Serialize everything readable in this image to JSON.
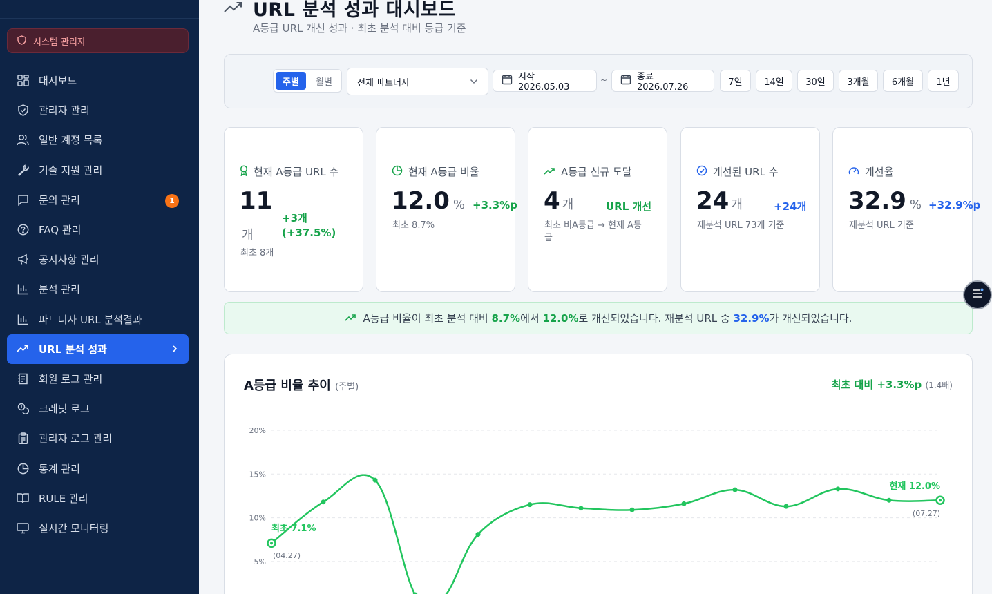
{
  "sidebar": {
    "admin_label": "시스템 관리자",
    "items": [
      {
        "label": "대시보드",
        "icon": "grid-icon"
      },
      {
        "label": "관리자 관리",
        "icon": "shield-icon"
      },
      {
        "label": "일반 계정 목록",
        "icon": "users-icon"
      },
      {
        "label": "기술 지원 관리",
        "icon": "wrench-icon"
      },
      {
        "label": "문의 관리",
        "icon": "message-icon",
        "badge": "1"
      },
      {
        "label": "FAQ 관리",
        "icon": "help-icon"
      },
      {
        "label": "공지사항 관리",
        "icon": "megaphone-icon"
      },
      {
        "label": "분석 관리",
        "icon": "bar-chart-icon"
      },
      {
        "label": "파트너사 URL 분석결과",
        "icon": "bar-chart-icon"
      },
      {
        "label": "URL 분석 성과",
        "icon": "trending-up-icon",
        "active": true
      },
      {
        "label": "회원 로그 관리",
        "icon": "log-icon"
      },
      {
        "label": "크레딧 로그",
        "icon": "coins-icon"
      },
      {
        "label": "관리자 로그 관리",
        "icon": "clipboard-icon"
      },
      {
        "label": "통계 관리",
        "icon": "pie-icon"
      },
      {
        "label": "RULE 관리",
        "icon": "book-icon"
      },
      {
        "label": "실시간 모니터링",
        "icon": "monitor-icon"
      }
    ]
  },
  "header": {
    "title": "URL 분석 성과 대시보드",
    "subtitle": "A등급 URL 개선 성과 · 최초 분석 대비 등급 기준"
  },
  "filters": {
    "period_weekly": "주별",
    "period_monthly": "월별",
    "partner_select": "전체 파트너사",
    "start_label": "시작 2026.05.03",
    "tilde": "~",
    "end_label": "종료 2026.07.26",
    "ranges": [
      "7일",
      "14일",
      "30일",
      "3개월",
      "6개월",
      "1년"
    ]
  },
  "cards": {
    "c1": {
      "label": "현재 A등급 URL 수",
      "value": "11",
      "unit": "개",
      "delta1": "+3개",
      "delta2": "(+37.5%)",
      "note": "최초 8개"
    },
    "c2": {
      "label": "현재 A등급 비율",
      "value": "12.0",
      "unit": "%",
      "delta": "+3.3%p",
      "note": "최초 8.7%"
    },
    "c3": {
      "label": "A등급 신규 도달",
      "value": "4",
      "unit": "개",
      "delta": "URL 개선",
      "note1": "최초 비A등급 → 현재 A등",
      "note2": "급"
    },
    "c4": {
      "label": "개선된 URL 수",
      "value": "24",
      "unit": "개",
      "delta": "+24개",
      "note": "재분석 URL 73개 기준"
    },
    "c5": {
      "label": "개선율",
      "value": "32.9",
      "unit": "%",
      "delta": "+32.9%p",
      "note": "재분석 URL 기준"
    }
  },
  "banner": {
    "t1": "A등급 비율이 최초 분석 대비 ",
    "v1": "8.7%",
    "t2": "에서 ",
    "v2": "12.0%",
    "t3": "로 개선되었습니다. 재분석 URL 중 ",
    "v3": "32.9%",
    "t4": "가 개선되었습니다."
  },
  "chart": {
    "title": "A등급 비율 추이",
    "title_sub": "(주별)",
    "right_main": "최초 대비 +3.3%p",
    "right_sub": "(1.4배)",
    "start_label": "최초 7.1%",
    "start_date": "(04.27)",
    "end_label": "현재 12.0%",
    "end_date": "(07.27)"
  },
  "chart_data": {
    "type": "line",
    "ylim": [
      0,
      20
    ],
    "yticks": [
      "20%",
      "15%",
      "10%",
      "5%"
    ],
    "x": [
      "04.27",
      "",
      "",
      "",
      "",
      "",
      "",
      "",
      "",
      "",
      "",
      "",
      "",
      "07.27"
    ],
    "series": [
      {
        "values": [
          7.1,
          11.8,
          14.3,
          1.2,
          1.0,
          8.1,
          11.5,
          11.1,
          10.9,
          11.6,
          13.2,
          11.3,
          13.3,
          12.0,
          12.0
        ]
      }
    ],
    "colors": {
      "line": "#22c55e"
    }
  }
}
